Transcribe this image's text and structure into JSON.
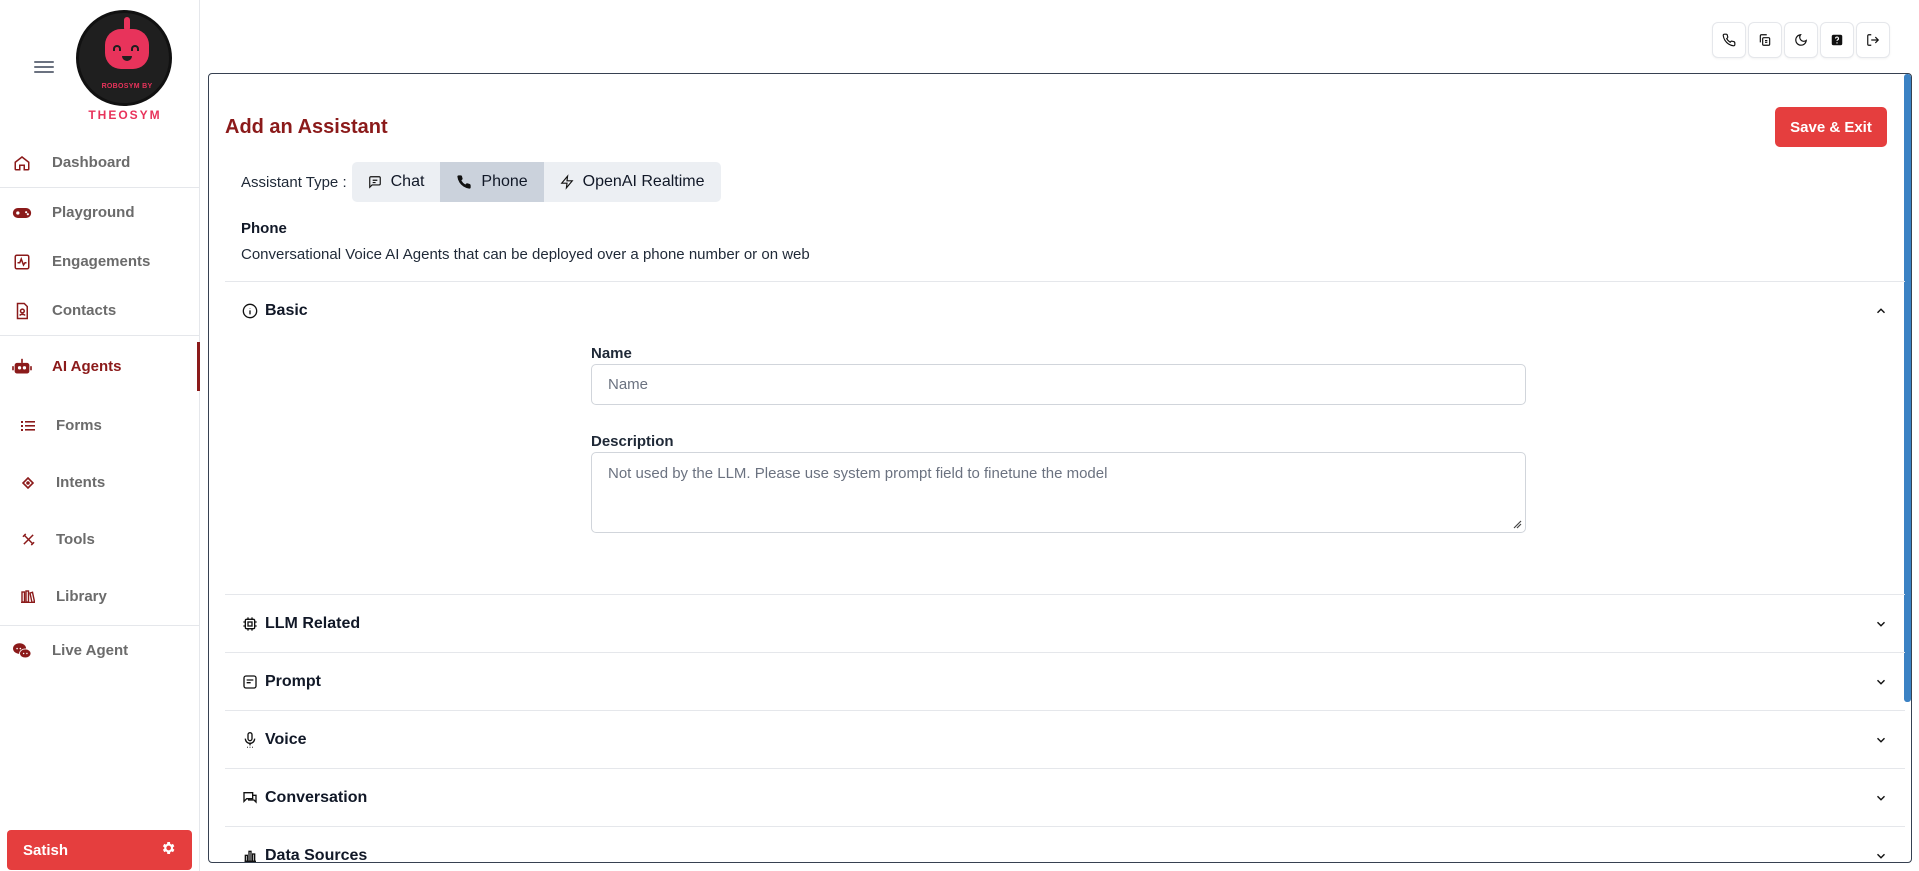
{
  "sidebar": {
    "logo_text": "ROBOSYM BY",
    "logo_brand": "THEOSYM",
    "items": [
      {
        "label": "Dashboard",
        "icon": "home-icon"
      },
      {
        "label": "Playground",
        "icon": "gamepad-icon"
      },
      {
        "label": "Engagements",
        "icon": "activity-icon"
      },
      {
        "label": "Contacts",
        "icon": "contact-icon"
      },
      {
        "label": "AI Agents",
        "icon": "robot-icon",
        "active": true
      },
      {
        "label": "Forms",
        "icon": "list-icon"
      },
      {
        "label": "Intents",
        "icon": "target-icon"
      },
      {
        "label": "Tools",
        "icon": "tools-icon"
      },
      {
        "label": "Library",
        "icon": "library-icon"
      },
      {
        "label": "Live Agent",
        "icon": "chat-bubbles-icon"
      }
    ],
    "user_label": "Satish"
  },
  "topbar": {
    "icons": [
      "phone-icon",
      "copy-icon",
      "moon-icon",
      "help-icon",
      "logout-icon"
    ]
  },
  "main": {
    "title": "Add an Assistant",
    "save_label": "Save & Exit",
    "assistant_type_label": "Assistant Type :",
    "types": [
      {
        "label": "Chat",
        "icon": "chat-icon"
      },
      {
        "label": "Phone",
        "icon": "phone-icon",
        "selected": true
      },
      {
        "label": "OpenAI Realtime",
        "icon": "bolt-icon"
      }
    ],
    "type_desc_title": "Phone",
    "type_desc": "Conversational Voice AI Agents that can be deployed over a phone number or on web",
    "sections": [
      {
        "label": "Basic",
        "icon": "info-icon",
        "expanded": true
      },
      {
        "label": "LLM Related",
        "icon": "chip-icon",
        "expanded": false
      },
      {
        "label": "Prompt",
        "icon": "document-icon",
        "expanded": false
      },
      {
        "label": "Voice",
        "icon": "microphone-icon",
        "expanded": false
      },
      {
        "label": "Conversation",
        "icon": "messages-icon",
        "expanded": false
      },
      {
        "label": "Data Sources",
        "icon": "bar-chart-icon",
        "expanded": false
      }
    ],
    "basic": {
      "name_label": "Name",
      "name_placeholder": "Name",
      "description_label": "Description",
      "description_placeholder": "Not used by the LLM. Please use system prompt field to finetune the model"
    }
  },
  "colors": {
    "accent_red": "#e53e3e",
    "brand_maroon": "#8b1a1a",
    "scrollbar_blue": "#3b82c4"
  }
}
